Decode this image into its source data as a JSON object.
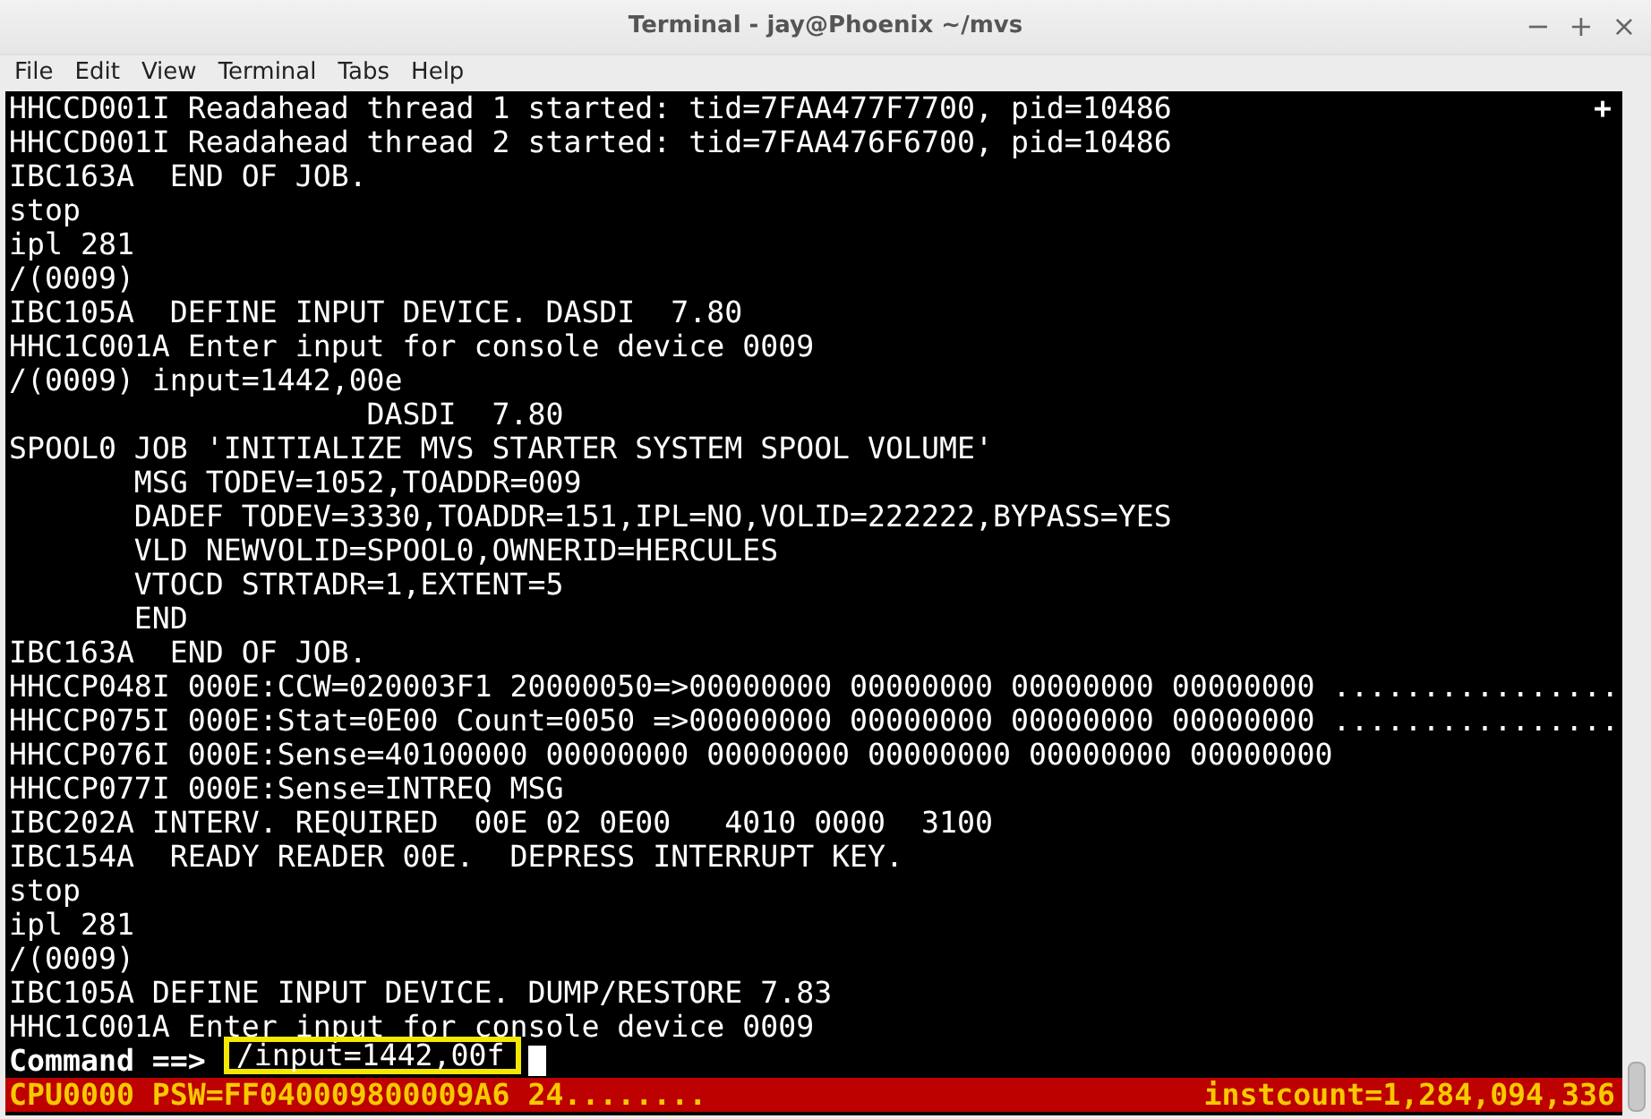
{
  "window": {
    "title": "Terminal - jay@Phoenix ~/mvs",
    "controls": [
      "−",
      "+",
      "×"
    ]
  },
  "menu": [
    "File",
    "Edit",
    "View",
    "Terminal",
    "Tabs",
    "Help"
  ],
  "terminal": {
    "marker": "+",
    "lines": [
      "HHCCD001I Readahead thread 1 started: tid=7FAA477F7700, pid=10486",
      "HHCCD001I Readahead thread 2 started: tid=7FAA476F6700, pid=10486",
      "IBC163A  END OF JOB.",
      "stop",
      "ipl 281",
      "/(0009)",
      "IBC105A  DEFINE INPUT DEVICE. DASDI  7.80",
      "HHC1C001A Enter input for console device 0009",
      "/(0009) input=1442,00e",
      "                    DASDI  7.80",
      "SPOOL0 JOB 'INITIALIZE MVS STARTER SYSTEM SPOOL VOLUME'",
      "       MSG TODEV=1052,TOADDR=009",
      "       DADEF TODEV=3330,TOADDR=151,IPL=NO,VOLID=222222,BYPASS=YES",
      "       VLD NEWVOLID=SPOOL0,OWNERID=HERCULES",
      "       VTOCD STRTADR=1,EXTENT=5",
      "       END",
      "IBC163A  END OF JOB.",
      "HHCCP048I 000E:CCW=020003F1 20000050=>00000000 00000000 00000000 00000000 ................",
      "HHCCP075I 000E:Stat=0E00 Count=0050 =>00000000 00000000 00000000 00000000 ................",
      "HHCCP076I 000E:Sense=40100000 00000000 00000000 00000000 00000000 00000000",
      "HHCCP077I 000E:Sense=INTREQ MSG",
      "IBC202A INTERV. REQUIRED  00E 02 0E00   4010 0000  3100",
      "IBC154A  READY READER 00E.  DEPRESS INTERRUPT KEY.",
      "stop",
      "ipl 281",
      "/(0009)",
      "IBC105A DEFINE INPUT DEVICE. DUMP/RESTORE 7.83",
      "HHC1C001A Enter input for console device 0009"
    ]
  },
  "command": {
    "prompt": "Command ==>",
    "value": "/input=1442,00f",
    "highlighted": true
  },
  "status_bar": {
    "left": "CPU0000 PSW=FF040009800009A6 24........",
    "right": "instcount=1,284,094,336"
  }
}
